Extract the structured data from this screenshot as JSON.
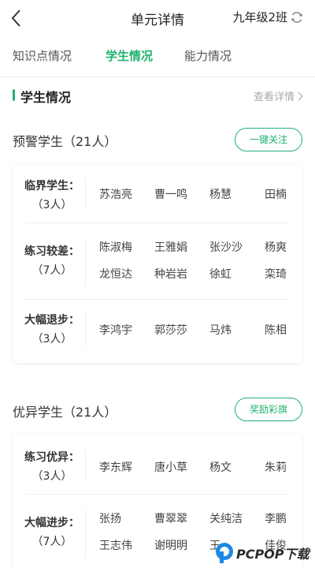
{
  "header": {
    "title": "单元详情",
    "class_name": "九年级2班"
  },
  "tabs": [
    {
      "label": "知识点情况",
      "active": false
    },
    {
      "label": "学生情况",
      "active": true
    },
    {
      "label": "能力情况",
      "active": false
    }
  ],
  "section": {
    "title": "学生情况",
    "detail_link": "查看详情"
  },
  "warning": {
    "title": "预警学生（21人）",
    "button": "一键关注",
    "rows": [
      {
        "label": "临界学生：",
        "count": "（3人）",
        "names": [
          "苏浩亮",
          "曹一鸣",
          "杨慧",
          "田楠"
        ]
      },
      {
        "label": "练习较差：",
        "count": "（7人）",
        "names": [
          "陈淑梅",
          "王雅娟",
          "张沙沙",
          "杨爽",
          "龙恒达",
          "种岩岩",
          "徐虹",
          "栾琦"
        ]
      },
      {
        "label": "大幅退步：",
        "count": "（3人）",
        "names": [
          "李鸿宇",
          "郭莎莎",
          "马炜",
          "陈相"
        ]
      }
    ]
  },
  "excellent": {
    "title": "优异学生（21人）",
    "button": "奖励彩旗",
    "rows": [
      {
        "label": "练习优异：",
        "count": "（3人）",
        "names": [
          "李东辉",
          "唐小草",
          "杨文",
          "朱莉"
        ]
      },
      {
        "label": "大幅进步：",
        "count": "（7人）",
        "names": [
          "张扬",
          "曹翠翠",
          "关纯洁",
          "李鹏",
          "王志伟",
          "谢明明",
          "王",
          "佳俊"
        ]
      }
    ]
  },
  "watermark": {
    "text": "PCPOP下载"
  },
  "colors": {
    "accent": "#1fb26f",
    "tab_highlight": "#c9f0dc"
  },
  "icons": {
    "back": "back-arrow-icon",
    "refresh": "refresh-icon",
    "chevron": "chevron-right-icon"
  }
}
